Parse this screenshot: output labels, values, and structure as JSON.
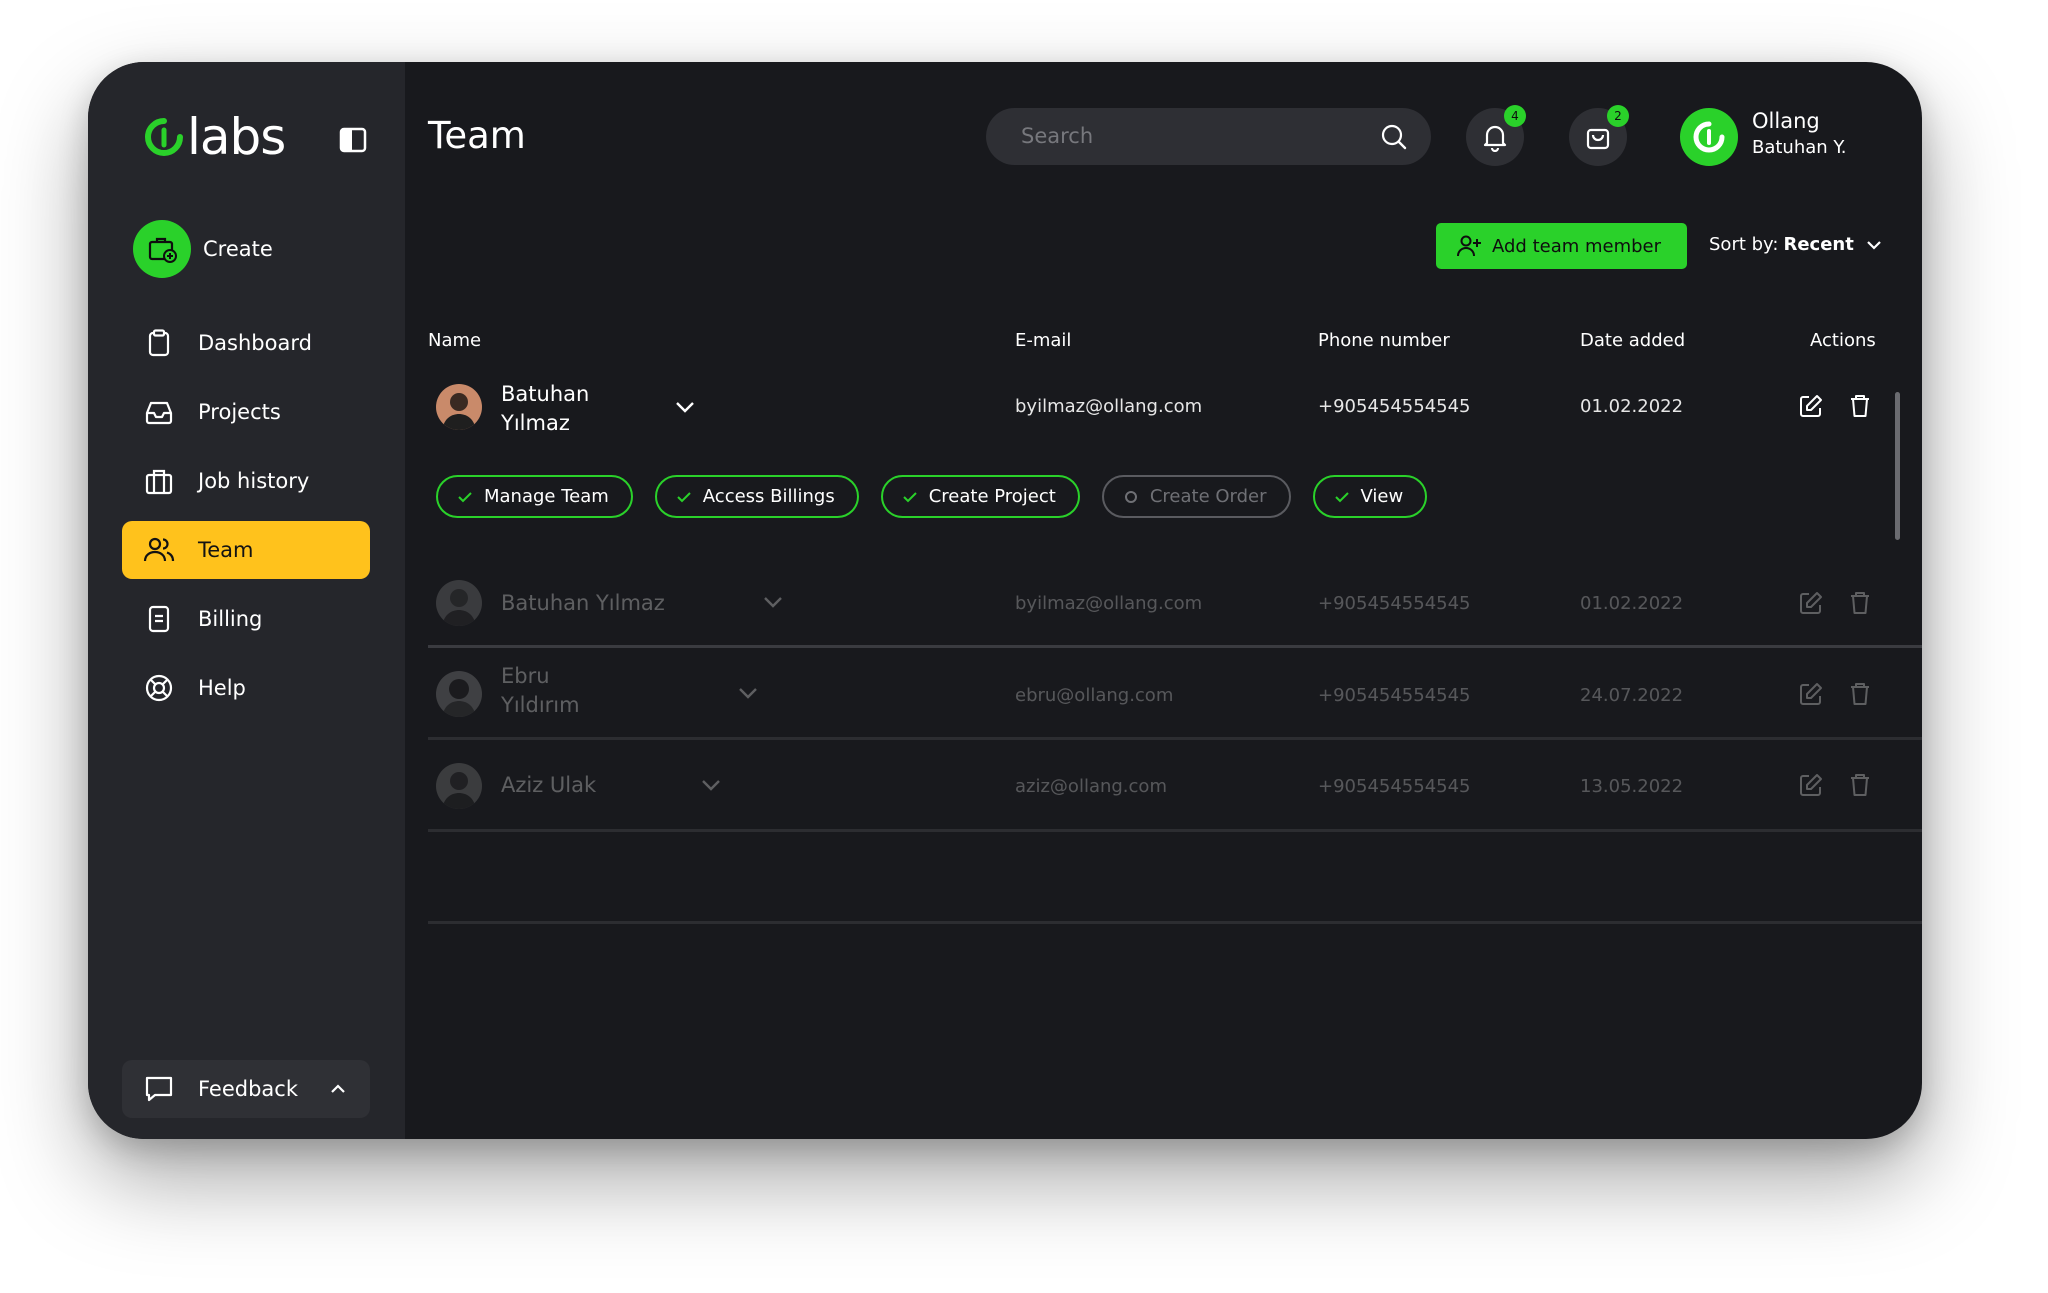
{
  "app": {
    "logo_text": "labs",
    "brand_color": "#2ad12a",
    "accent_color": "#ffc21c"
  },
  "sidebar": {
    "create_label": "Create",
    "items": [
      {
        "label": "Dashboard",
        "icon": "clipboard-icon"
      },
      {
        "label": "Projects",
        "icon": "inbox-icon"
      },
      {
        "label": "Job history",
        "icon": "briefcase-icon"
      },
      {
        "label": "Team",
        "icon": "users-icon",
        "active": true
      },
      {
        "label": "Billing",
        "icon": "document-icon"
      },
      {
        "label": "Help",
        "icon": "lifebuoy-icon"
      }
    ],
    "feedback_label": "Feedback"
  },
  "header": {
    "title": "Team",
    "search_placeholder": "Search",
    "notifications_count": "4",
    "cart_count": "2",
    "profile": {
      "org": "Ollang",
      "user": "Batuhan Y."
    }
  },
  "toolbar": {
    "add_member_label": "Add team member",
    "sort_prefix": "Sort by:",
    "sort_value": "Recent"
  },
  "table": {
    "columns": [
      "Name",
      "E-mail",
      "Phone number",
      "Date added",
      "Actions"
    ],
    "rows": [
      {
        "name": "Batuhan Yılmaz",
        "email": "byilmaz@ollang.com",
        "phone": "+905454554545",
        "date": "01.02.2022"
      },
      {
        "name": "Batuhan Yılmaz",
        "email": "byilmaz@ollang.com",
        "phone": "+905454554545",
        "date": "01.02.2022"
      },
      {
        "name": "Ebru Yıldırım",
        "email": "ebru@ollang.com",
        "phone": "+905454554545",
        "date": "24.07.2022"
      },
      {
        "name": "Aziz Ulak",
        "email": "aziz@ollang.com",
        "phone": "+905454554545",
        "date": "13.05.2022"
      }
    ],
    "expanded_row_first_line": "Batuhan",
    "expanded_row_second_line": "Yılmaz",
    "row3_first_line": "Ebru",
    "row3_second_line": "Yıldırım",
    "permissions": [
      {
        "label": "Manage Team",
        "enabled": true
      },
      {
        "label": "Access Billings",
        "enabled": true
      },
      {
        "label": "Create Project",
        "enabled": true
      },
      {
        "label": "Create Order",
        "enabled": false
      },
      {
        "label": "View",
        "enabled": true
      }
    ]
  }
}
